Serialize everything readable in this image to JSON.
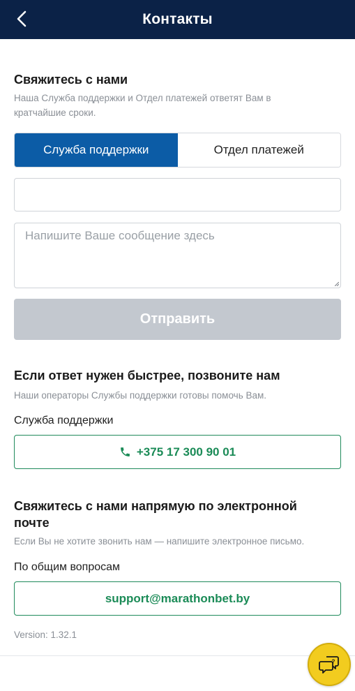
{
  "header": {
    "title": "Контакты",
    "back_icon": "chevron-left-icon"
  },
  "contact_form": {
    "title": "Свяжитесь с нами",
    "subtitle": "Наша Служба поддержки и Отдел платежей ответят Вам в кратчайшие сроки.",
    "tabs": [
      {
        "label": "Служба поддержки",
        "active": true
      },
      {
        "label": "Отдел платежей",
        "active": false
      }
    ],
    "email_value": "",
    "message_placeholder": "Напишите Ваше сообщение здесь",
    "send_label": "Отправить"
  },
  "call_section": {
    "title": "Если ответ нужен быстрее, позвоните нам",
    "subtitle": "Наши операторы Службы поддержки готовы помочь Вам.",
    "label": "Служба поддержки",
    "phone": "+375 17 300 90 01",
    "phone_icon": "phone-icon"
  },
  "email_section": {
    "title": "Свяжитесь с нами напрямую по электронной почте",
    "subtitle": "Если Вы не хотите звонить нам — напишите электронное письмо.",
    "label": "По общим вопросам",
    "email": "support@marathonbet.by"
  },
  "version": "Version: 1.32.1",
  "chat_button": {
    "icon": "chat-help-icon"
  },
  "colors": {
    "header_bg": "#0b2247",
    "tab_active_bg": "#0c5ca6",
    "send_disabled_bg": "#c3c8cf",
    "accent_green": "#1b8b57",
    "chat_fab_bg": "#f2cc1f"
  }
}
